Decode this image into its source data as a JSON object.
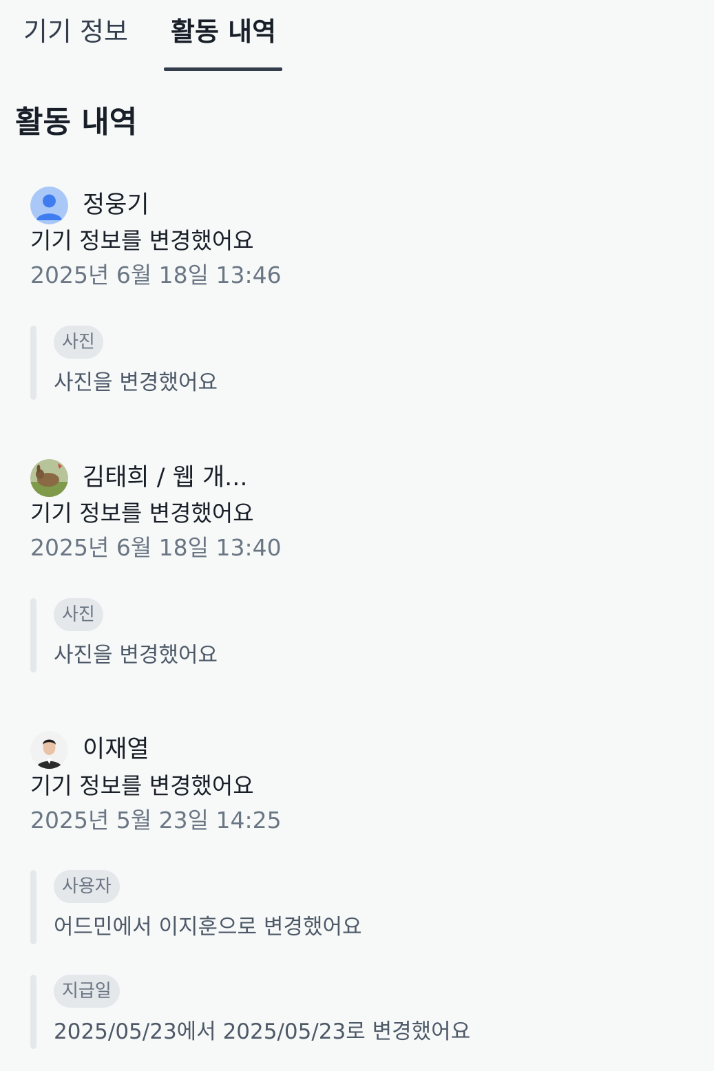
{
  "tabs": [
    {
      "label": "기기 정보",
      "active": false
    },
    {
      "label": "활동 내역",
      "active": true
    }
  ],
  "section_title": "활동 내역",
  "entries": [
    {
      "user": "정웅기",
      "avatar": "default-person-avatar",
      "action": "기기 정보를 변경했어요",
      "datetime": "2025년 6월 18일 13:46",
      "changes": [
        {
          "tag": "사진",
          "text": "사진을 변경했어요"
        }
      ]
    },
    {
      "user": "김태희 / 웹 개...",
      "avatar": "photo-avatar-animal",
      "action": "기기 정보를 변경했어요",
      "datetime": "2025년 6월 18일 13:40",
      "changes": [
        {
          "tag": "사진",
          "text": "사진을 변경했어요"
        }
      ]
    },
    {
      "user": "이재열",
      "avatar": "photo-avatar-person",
      "action": "기기 정보를 변경했어요",
      "datetime": "2025년 5월 23일 14:25",
      "changes": [
        {
          "tag": "사용자",
          "text": "어드민에서 이지훈으로 변경했어요"
        },
        {
          "tag": "지급일",
          "text": "2025/05/23에서 2025/05/23로 변경했어요"
        }
      ]
    }
  ],
  "colors": {
    "background": "#f7f9f9",
    "text_primary": "#191f28",
    "text_secondary": "#6b7684",
    "tag_bg": "#e5e8eb",
    "default_avatar": "#3f7cf0"
  }
}
